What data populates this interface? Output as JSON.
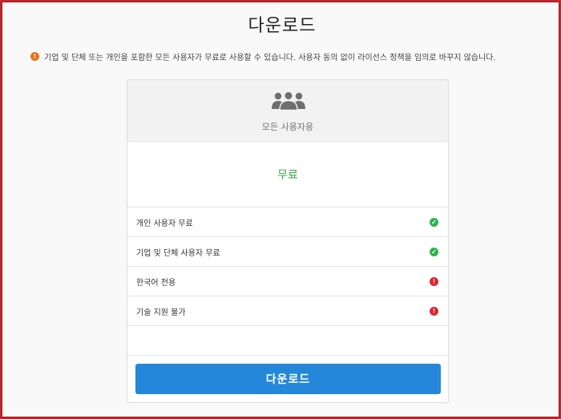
{
  "page": {
    "title": "다운로드",
    "notice": "기업 및 단체 또는 개인을 포함한 모든 사용자가 무료로 사용할 수 있습니다. 사용자 동의 없이 라이선스 정책을 임의로 바꾸지 않습니다.",
    "notice_icon": "exclamation-icon"
  },
  "colors": {
    "border": "#c1272d",
    "price": "#3aa64a",
    "ok": "#2fb24c",
    "no": "#d9272e",
    "button": "#2487d9",
    "notice_icon": "#e8741c"
  },
  "plan": {
    "icon": "users-group-icon",
    "name": "모든 사용자용",
    "price": "무료",
    "features": [
      {
        "label": "개인 사용자 무료",
        "status": "check-icon"
      },
      {
        "label": "기업 및 단체 사용자 무료",
        "status": "check-icon"
      },
      {
        "label": "한국어 전용",
        "status": "exclamation-icon"
      },
      {
        "label": "기술 지원 불가",
        "status": "exclamation-icon"
      }
    ],
    "button_label": "다운로드"
  }
}
